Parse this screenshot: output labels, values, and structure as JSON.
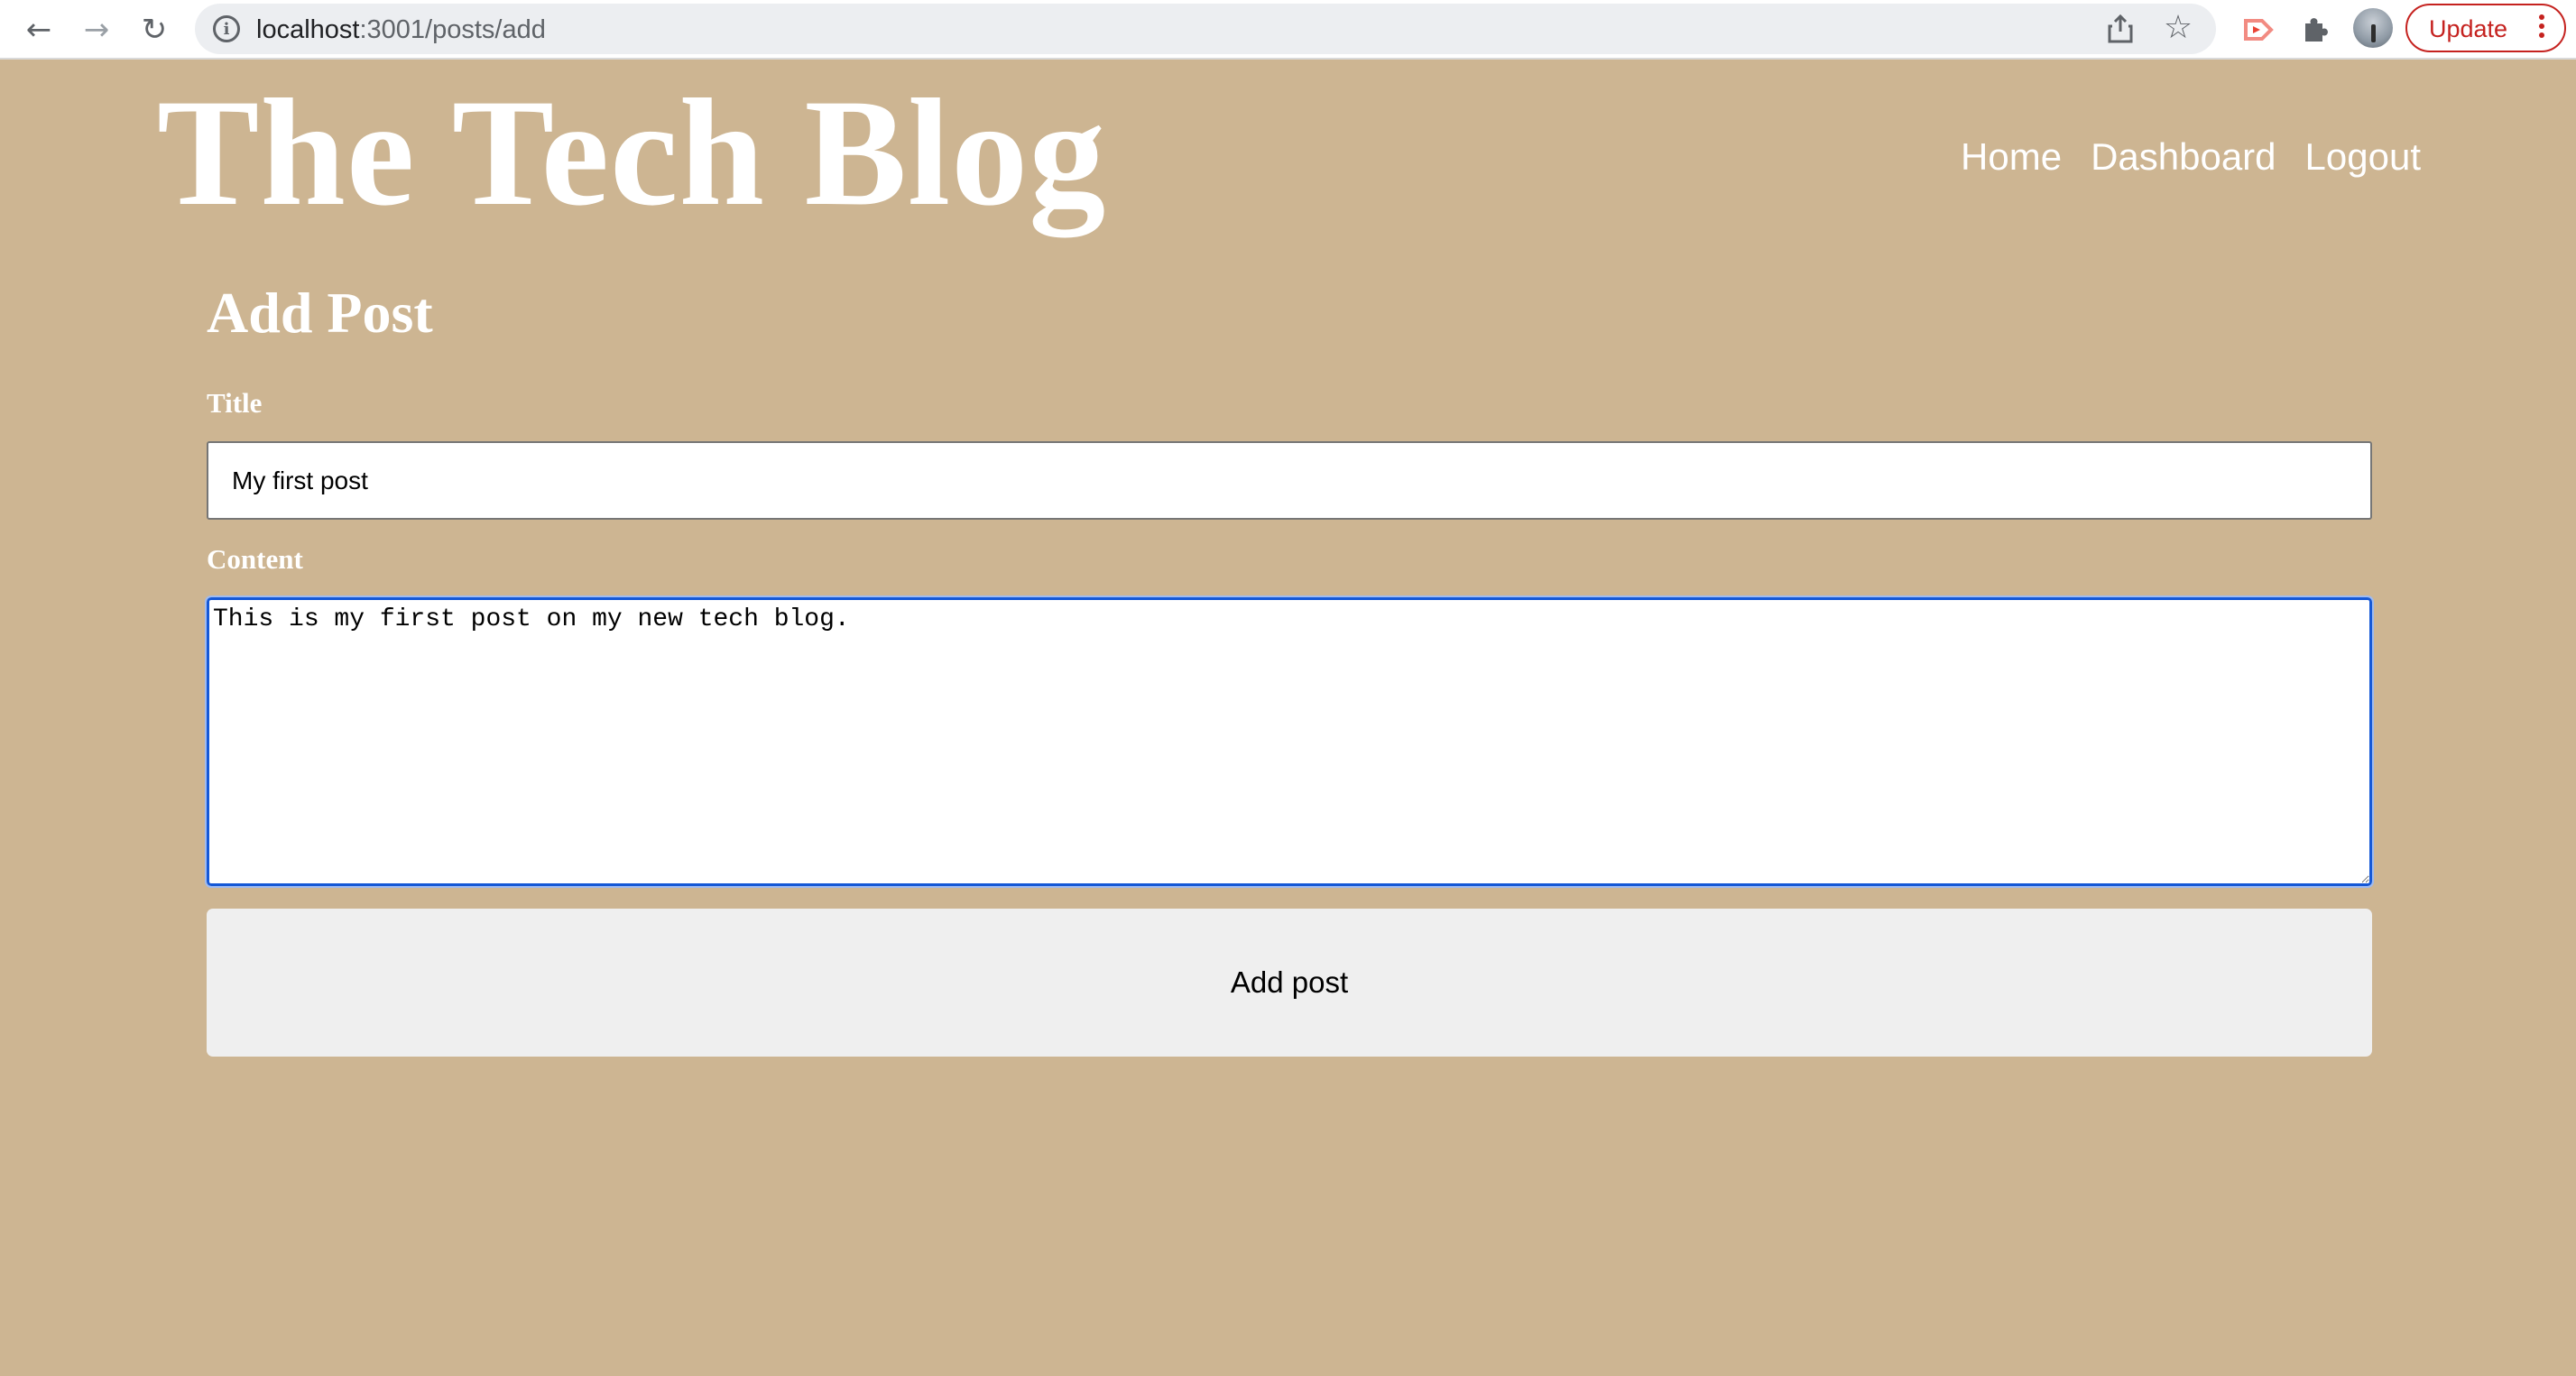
{
  "browser": {
    "url_host": "localhost",
    "url_path": ":3001/posts/add",
    "update_label": "Update"
  },
  "site": {
    "title": "The Tech Blog",
    "nav": [
      "Home",
      "Dashboard",
      "Logout"
    ]
  },
  "form": {
    "heading": "Add Post",
    "title_label": "Title",
    "title_value": "My first post",
    "content_label": "Content",
    "content_value": "This is my first post on my new tech blog.",
    "submit_label": "Add post"
  },
  "colors": {
    "page_bg": "#cdb592",
    "focus_ring": "#1558d6",
    "update_red": "#c5221f"
  }
}
